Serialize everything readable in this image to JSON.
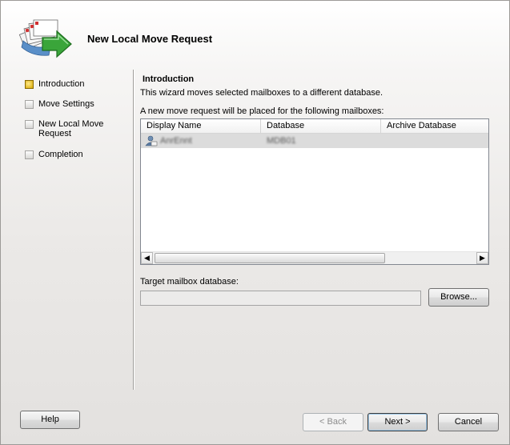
{
  "wizard": {
    "title": "New Local Move Request"
  },
  "steps": [
    {
      "label": "Introduction",
      "active": true
    },
    {
      "label": "Move Settings",
      "active": false
    },
    {
      "label": "New Local Move Request",
      "active": false
    },
    {
      "label": "Completion",
      "active": false
    }
  ],
  "intro": {
    "heading": "Introduction",
    "description": "This wizard moves selected mailboxes to a different database.",
    "mailboxes_note": "A new move request will be placed for the following mailboxes:"
  },
  "mailbox_list": {
    "columns": [
      "Display Name",
      "Database",
      "Archive Database"
    ],
    "rows": [
      {
        "display_name": "AnrEnnt",
        "database": "MDB01",
        "archive_database": ""
      }
    ]
  },
  "target": {
    "label": "Target mailbox database:",
    "value": ""
  },
  "buttons": {
    "browse": "Browse...",
    "help": "Help",
    "back": "< Back",
    "next": "Next >",
    "cancel": "Cancel"
  },
  "colors": {
    "selected_row": "#dcdcdc",
    "arrow_green": "#3aa53a",
    "active_step": "#e8c02a"
  },
  "icons": {
    "wizard": "mail-move-icon",
    "user": "mailbox-user-icon"
  }
}
